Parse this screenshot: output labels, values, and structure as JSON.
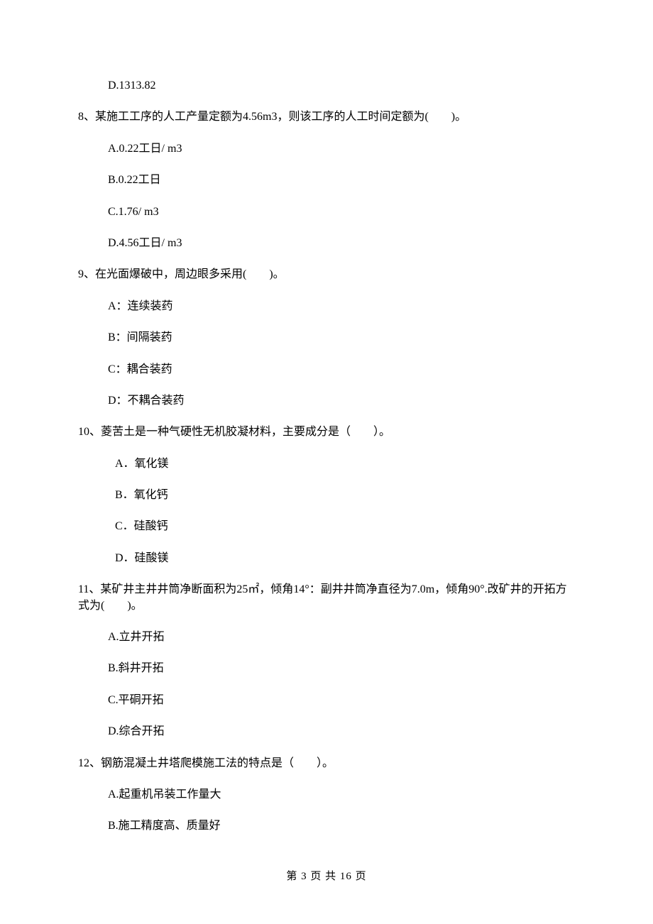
{
  "q7": {
    "d": "D.1313.82"
  },
  "q8": {
    "stem": "8、某施工工序的人工产量定额为4.56m3，则该工序的人工时间定额为(　　)。",
    "a": "A.0.22工日/ m3",
    "b": "B.0.22工日",
    "c": "C.1.76/ m3",
    "d": "D.4.56工日/ m3"
  },
  "q9": {
    "stem": "9、在光面爆破中，周边眼多采用(　　)。",
    "a": "A：连续装药",
    "b": "B：间隔装药",
    "c": "C：耦合装药",
    "d": "D：不耦合装药"
  },
  "q10": {
    "stem": "10、菱苦土是一种气硬性无机胶凝材料，主要成分是（　　）。",
    "a": "A．氧化镁",
    "b": "B．氧化钙",
    "c": "C．硅酸钙",
    "d": "D．硅酸镁"
  },
  "q11": {
    "stem": "11、某矿井主井井筒净断面积为25㎡，倾角14°：副井井筒净直径为7.0m，倾角90°.改矿井的开拓方式为(　　)。",
    "a": "A.立井开拓",
    "b": "B.斜井开拓",
    "c": "C.平硐开拓",
    "d": "D.综合开拓"
  },
  "q12": {
    "stem": "12、钢筋混凝土井塔爬模施工法的特点是（　　）。",
    "a": "A.起重机吊装工作量大",
    "b": "B.施工精度高、质量好"
  },
  "footer": "第 3 页 共 16 页"
}
